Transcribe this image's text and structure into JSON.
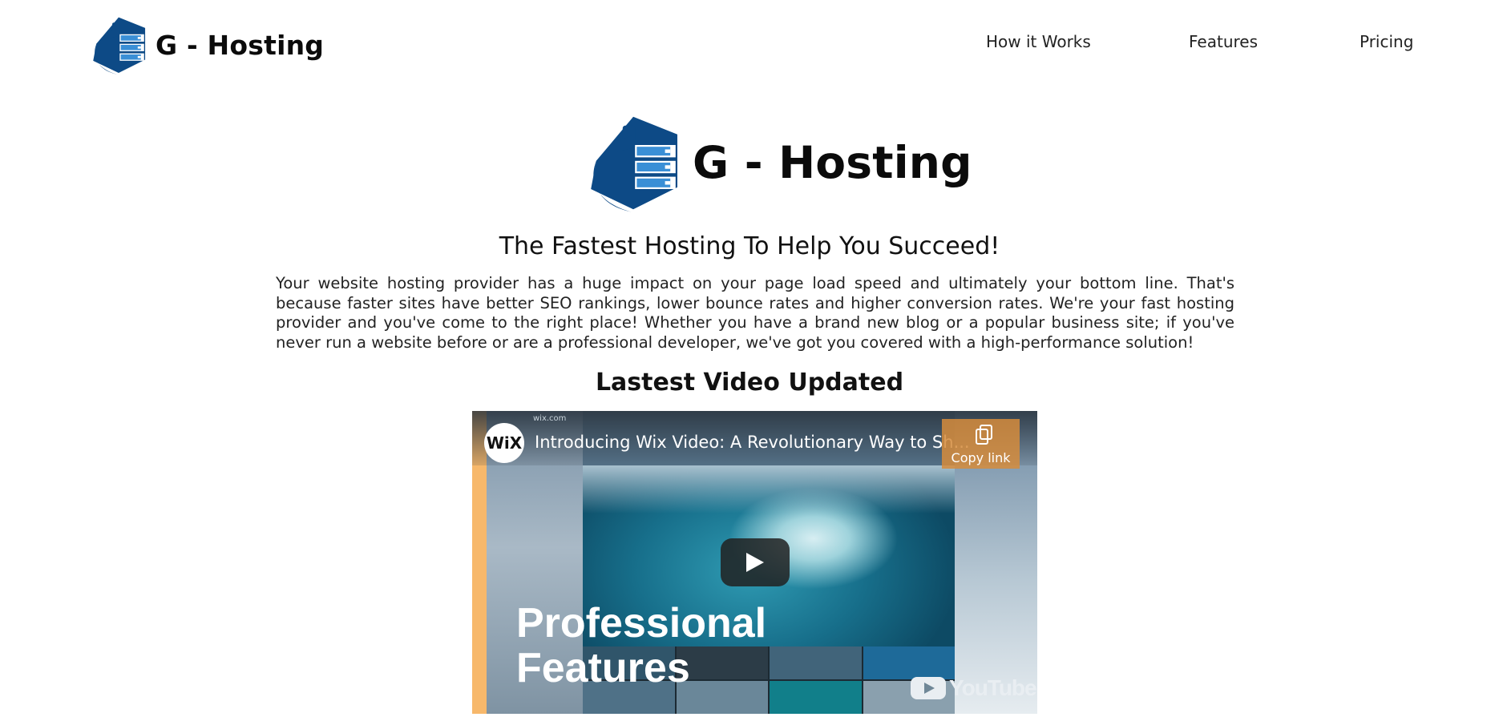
{
  "header": {
    "brand": "G - Hosting",
    "nav": [
      {
        "label": "How it Works"
      },
      {
        "label": "Features"
      },
      {
        "label": "Pricing"
      }
    ]
  },
  "hero": {
    "brand": "G - Hosting",
    "headline": "The Fastest Hosting To Help You Succeed!",
    "intro": "Your website hosting provider has a huge impact on your page load speed and ultimately your bottom line. That's because faster sites have better SEO rankings, lower bounce rates and higher conversion rates. We're your fast hosting provider and you've come to the right place! Whether you have a brand new blog or a popular business site; if you've never run a website before or are a professional developer, we've got you covered with a high-performance solution!"
  },
  "video_section": {
    "heading": "Lastest Video Updated",
    "video": {
      "url_text": "wix.com",
      "channel_logo": "WiX",
      "title": "Introducing Wix Video: A Revolutionary Way to Sh...",
      "copy_label": "Copy link",
      "overlay_text": [
        "Professional",
        "Features"
      ],
      "platform_label": "YouTube"
    }
  },
  "colors": {
    "logo_blue": "#0d4a86",
    "logo_light": "#3a8fd6",
    "video_accent": "#f7b86b"
  },
  "icons": [
    "server-thumbs-up-logo-icon",
    "copy-link-icon",
    "play-icon",
    "youtube-icon"
  ]
}
